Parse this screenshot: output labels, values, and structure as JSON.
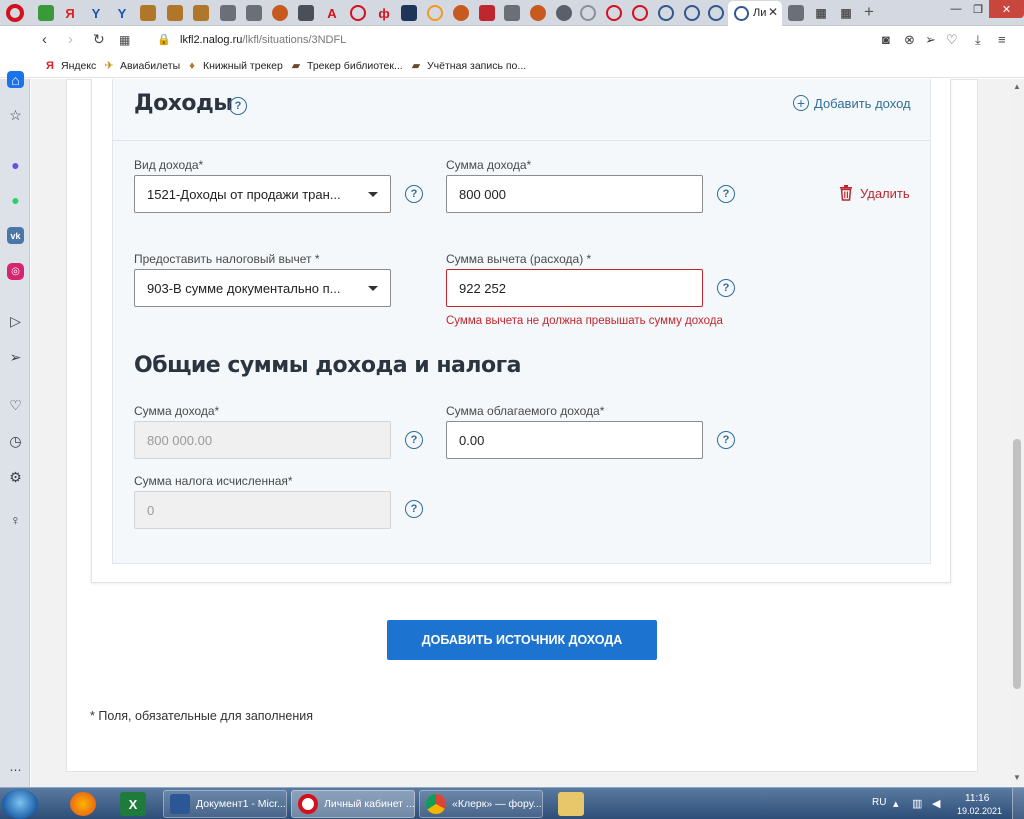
{
  "browser": {
    "active_tab_title": "Ли",
    "url_host": "lkfl2.nalog.ru",
    "url_path": "/lkfl/situations/3NDFL",
    "bookmarks": [
      {
        "label": "Яндекс",
        "icon": "yandex-icon"
      },
      {
        "label": "Авиабилеты",
        "icon": "plane-icon"
      },
      {
        "label": "Книжный трекер",
        "icon": "book-icon"
      },
      {
        "label": "Трекер библиотек...",
        "icon": "library-icon"
      },
      {
        "label": "Учётная запись по...",
        "icon": "account-icon"
      }
    ]
  },
  "incomes": {
    "title": "Доходы",
    "add_income_label": "Добавить доход",
    "income_type_label": "Вид дохода*",
    "income_type_value": "1521-Доходы от продажи тран...",
    "income_amount_label": "Сумма дохода*",
    "income_amount_value": "800 000",
    "delete_label": "Удалить",
    "deduction_label": "Предоставить налоговый вычет *",
    "deduction_value": "903-В сумме документально п...",
    "deduction_amount_label": "Сумма вычета (расхода) *",
    "deduction_amount_value": "922 252",
    "deduction_error": "Сумма вычета не должна превышать сумму дохода"
  },
  "totals": {
    "title": "Общие суммы дохода и налога",
    "total_income_label": "Сумма дохода*",
    "total_income_value": "800 000.00",
    "taxable_income_label": "Сумма облагаемого дохода*",
    "taxable_income_value": "0.00",
    "tax_calculated_label": "Сумма налога исчисленная*",
    "tax_calculated_value": "0"
  },
  "add_source_button": "ДОБАВИТЬ ИСТОЧНИК ДОХОДА",
  "required_note": "* Поля, обязательные для заполнения",
  "help_glyph": "?",
  "taskbar": {
    "tasks": [
      {
        "label": "Документ1 - Micr..."
      },
      {
        "label": "Личный кабинет ..."
      },
      {
        "label": "«Клерк» — фору..."
      }
    ],
    "language": "RU",
    "time": "11:16",
    "date": "19.02.2021"
  },
  "colors": {
    "primary_button": "#1d74d0",
    "link_blue": "#2f6e98",
    "error_red": "#c0262e",
    "opera_red": "#d3101b"
  }
}
